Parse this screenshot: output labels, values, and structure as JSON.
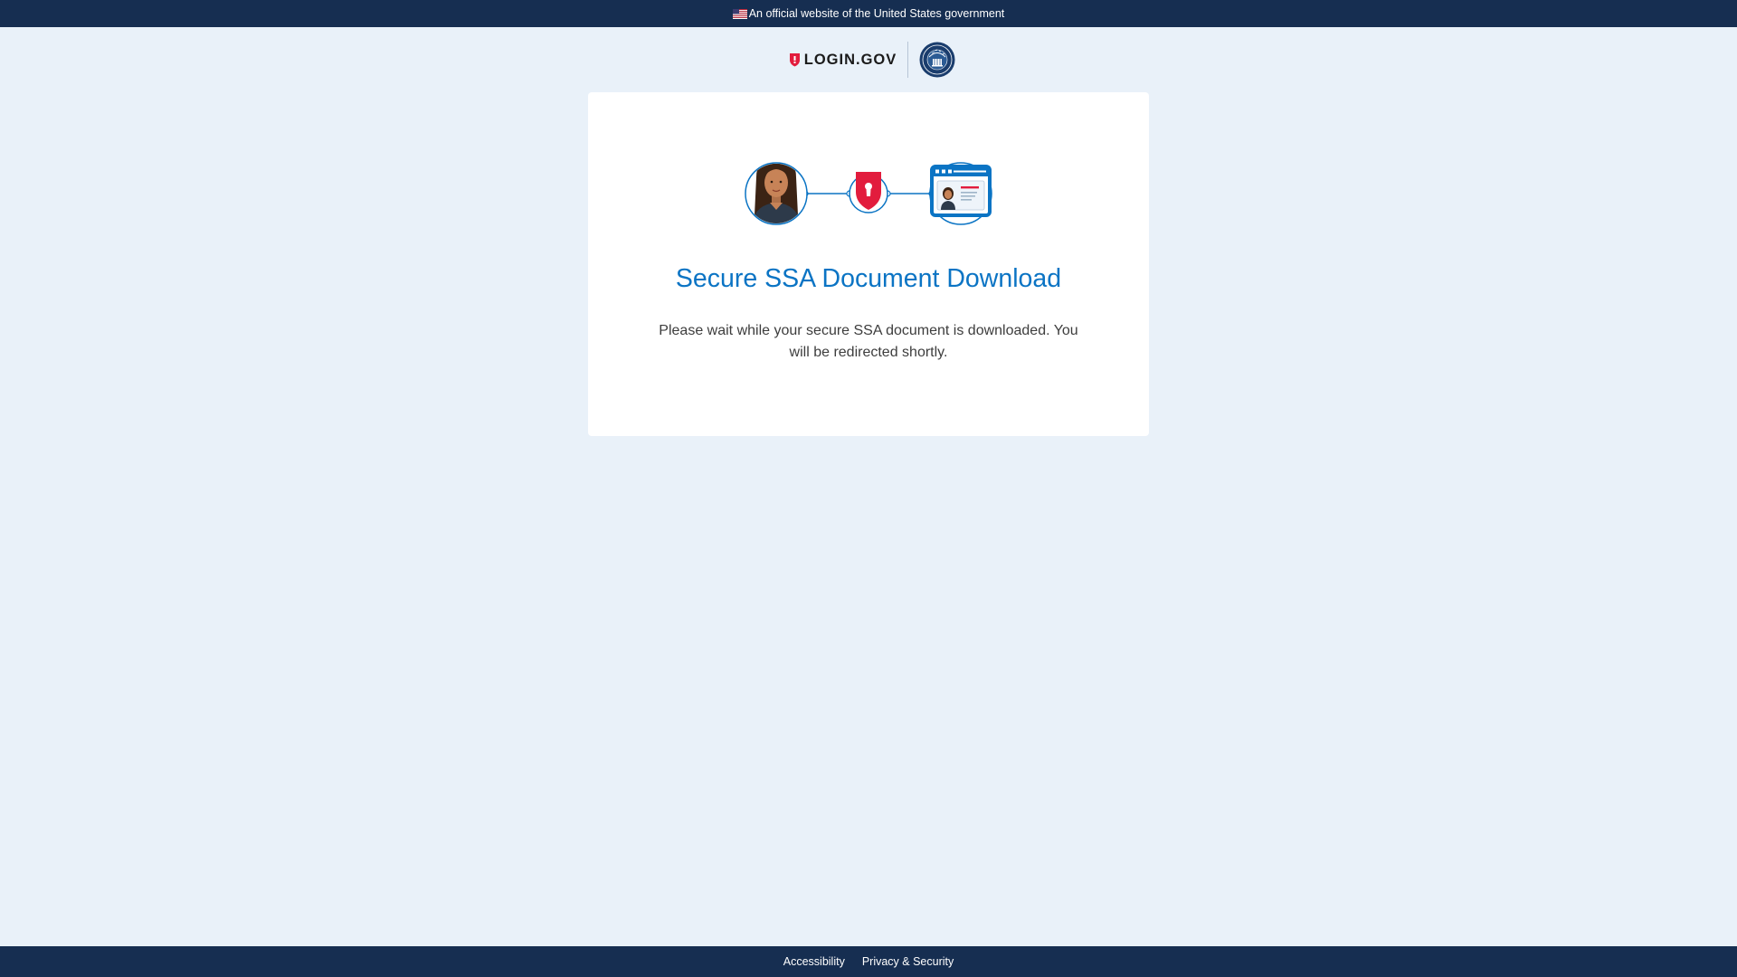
{
  "banner": {
    "text": "An official website of the United States government",
    "icon": "us-flag-icon"
  },
  "header": {
    "logo_text": "LOGIN.GOV",
    "logo_icon": "shield-icon",
    "partner_icon": "ssa-seal-icon"
  },
  "card": {
    "title": "Secure SSA Document Download",
    "message": "Please wait while your secure SSA document is downloaded. You will be redirected shortly.",
    "illustration": "person-shield-id-card-illustration"
  },
  "footer": {
    "links": [
      "Accessibility",
      "Privacy & Security"
    ]
  },
  "colors": {
    "banner_bg": "#162e51",
    "page_bg": "#e9f1f9",
    "title": "#0b74c4",
    "shield_red": "#e21c3d",
    "accent_blue": "#0b74c4"
  }
}
